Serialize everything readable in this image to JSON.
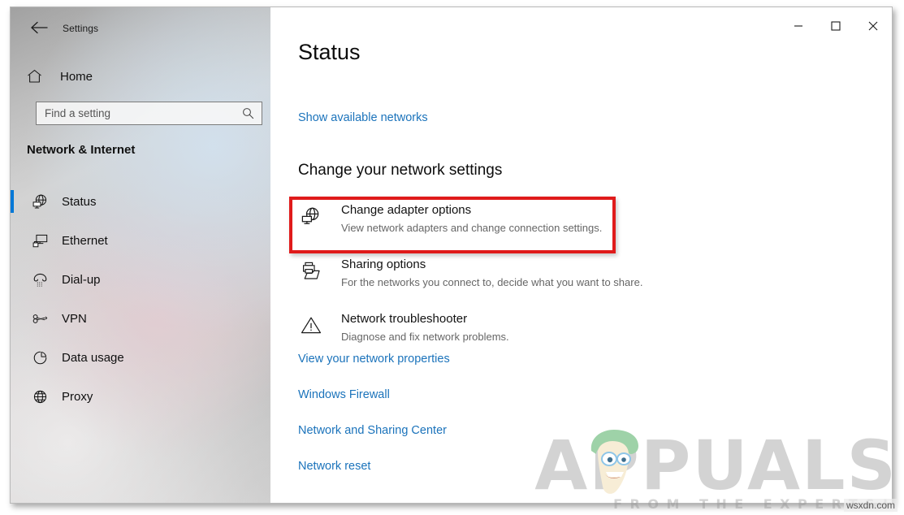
{
  "window": {
    "app_title": "Settings",
    "back_icon": "back-arrow-icon",
    "controls": {
      "minimize": "minimize-icon",
      "maximize": "maximize-icon",
      "close": "close-icon"
    }
  },
  "sidebar": {
    "home_label": "Home",
    "home_icon": "home-icon",
    "search": {
      "placeholder": "Find a setting",
      "value": "",
      "icon": "search-icon"
    },
    "section_title": "Network & Internet",
    "accent_color": "#0078d7",
    "items": [
      {
        "label": "Status",
        "icon": "globe-network-icon",
        "selected": true
      },
      {
        "label": "Ethernet",
        "icon": "ethernet-icon",
        "selected": false
      },
      {
        "label": "Dial-up",
        "icon": "telephone-icon",
        "selected": false
      },
      {
        "label": "VPN",
        "icon": "vpn-key-icon",
        "selected": false
      },
      {
        "label": "Data usage",
        "icon": "pie-chart-icon",
        "selected": false
      },
      {
        "label": "Proxy",
        "icon": "globe-icon",
        "selected": false
      }
    ]
  },
  "main": {
    "page_title": "Status",
    "show_available_networks": "Show available networks",
    "section_heading": "Change your network settings",
    "settings_rows": [
      {
        "title": "Change adapter options",
        "subtitle": "View network adapters and change connection settings.",
        "icon": "network-adapter-icon",
        "highlighted": true
      },
      {
        "title": "Sharing options",
        "subtitle": "For the networks you connect to, decide what you want to share.",
        "icon": "sharing-printer-folder-icon",
        "highlighted": false
      },
      {
        "title": "Network troubleshooter",
        "subtitle": "Diagnose and fix network problems.",
        "icon": "warning-triangle-icon",
        "highlighted": false
      }
    ],
    "bottom_links": [
      "View your network properties",
      "Windows Firewall",
      "Network and Sharing Center",
      "Network reset"
    ],
    "link_color": "#1b73bb",
    "highlight_color": "#e01b1b"
  },
  "watermark": {
    "brand": "APPUALS",
    "tagline": "FROM THE EXPERTS!",
    "credit": "wsxdn.com"
  }
}
